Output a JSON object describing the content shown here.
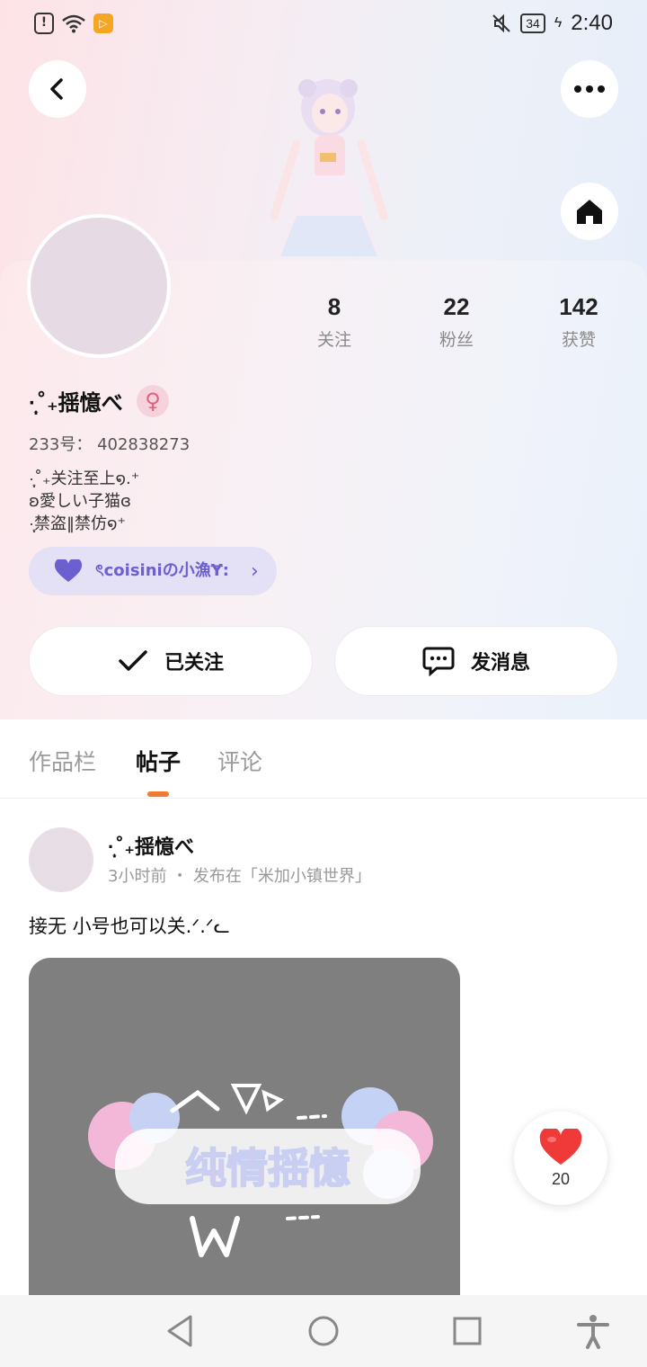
{
  "status_bar": {
    "time": "2:40",
    "battery": "34"
  },
  "profile": {
    "username": "·̩͙˚₊揺憶べ",
    "uid": "233号： 402838273",
    "bio": [
      "·̩͙˚₊关注至上໑.⁺",
      " ʚ愛しい子猫ɞ",
      "·̩͙禁盗‖禁仿໑⁺"
    ],
    "club": "ৎcoisiniの小漁Ɏ:",
    "stats": [
      {
        "value": "8",
        "label": "关注"
      },
      {
        "value": "22",
        "label": "粉丝"
      },
      {
        "value": "142",
        "label": "获赞"
      }
    ],
    "follow_label": "已关注",
    "message_label": "发消息"
  },
  "tabs": [
    {
      "label": "作品栏"
    },
    {
      "label": "帖子"
    },
    {
      "label": "评论"
    }
  ],
  "post": {
    "author": "·̩͙˚₊揺憶べ",
    "meta": "3小时前 ・ 发布在「米加小镇世界」",
    "text": "接无 小号也可以关.ᐟ.ᐟᓚ",
    "likes": "20"
  },
  "colors": {
    "accent": "#ef7a30",
    "club_text": "#6c5fd0",
    "like": "#f03a3a"
  }
}
